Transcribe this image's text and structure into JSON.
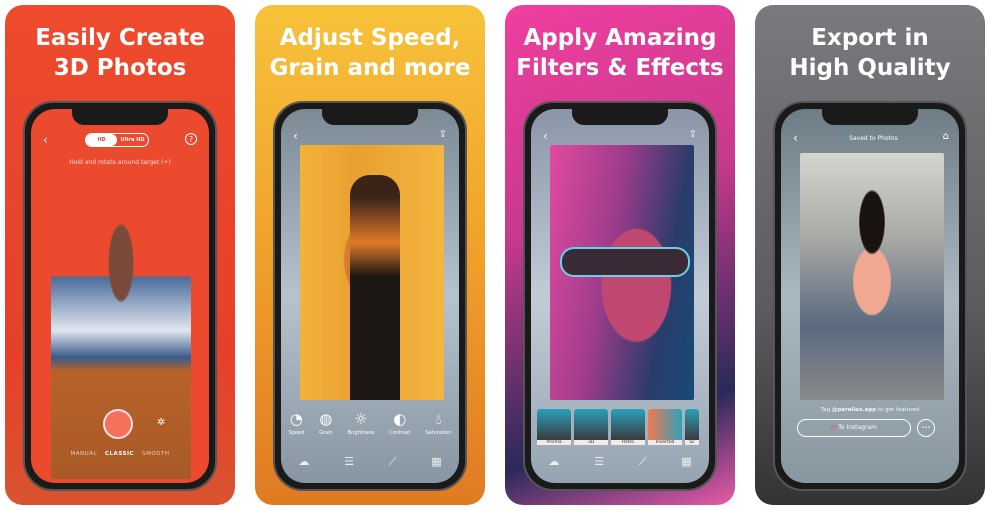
{
  "panels": [
    {
      "headline": "Easily Create\n3D Photos",
      "toggle": {
        "options": [
          "HD",
          "Ultra HD"
        ],
        "selected": "HD"
      },
      "hint": "Hold and rotate around target (+)",
      "modes": [
        "MANUAL",
        "CLASSIC",
        "SMOOTH"
      ],
      "selected_mode": "CLASSIC"
    },
    {
      "headline": "Adjust Speed,\nGrain and more",
      "tools": [
        "Speed",
        "Grain",
        "Brightness",
        "Contrast",
        "Saturation"
      ]
    },
    {
      "headline": "Apply Amazing\nFilters & Effects",
      "filters": [
        "Prisma",
        "3D",
        "Retro",
        "Inverted",
        "Sc"
      ]
    },
    {
      "headline": "Export in\nHigh Quality",
      "status": "Saved to Photos",
      "tag_prefix": "Tag ",
      "tag_handle": "@parallax.app",
      "tag_suffix": " to get featured",
      "instagram_button": "To Instagram",
      "more_button": "•••"
    }
  ],
  "colors": {
    "panel1": "#ee4a2c",
    "panel2": "#f0a02a",
    "panel3": "#f03ea0",
    "panel4": "#6a6a6e"
  }
}
